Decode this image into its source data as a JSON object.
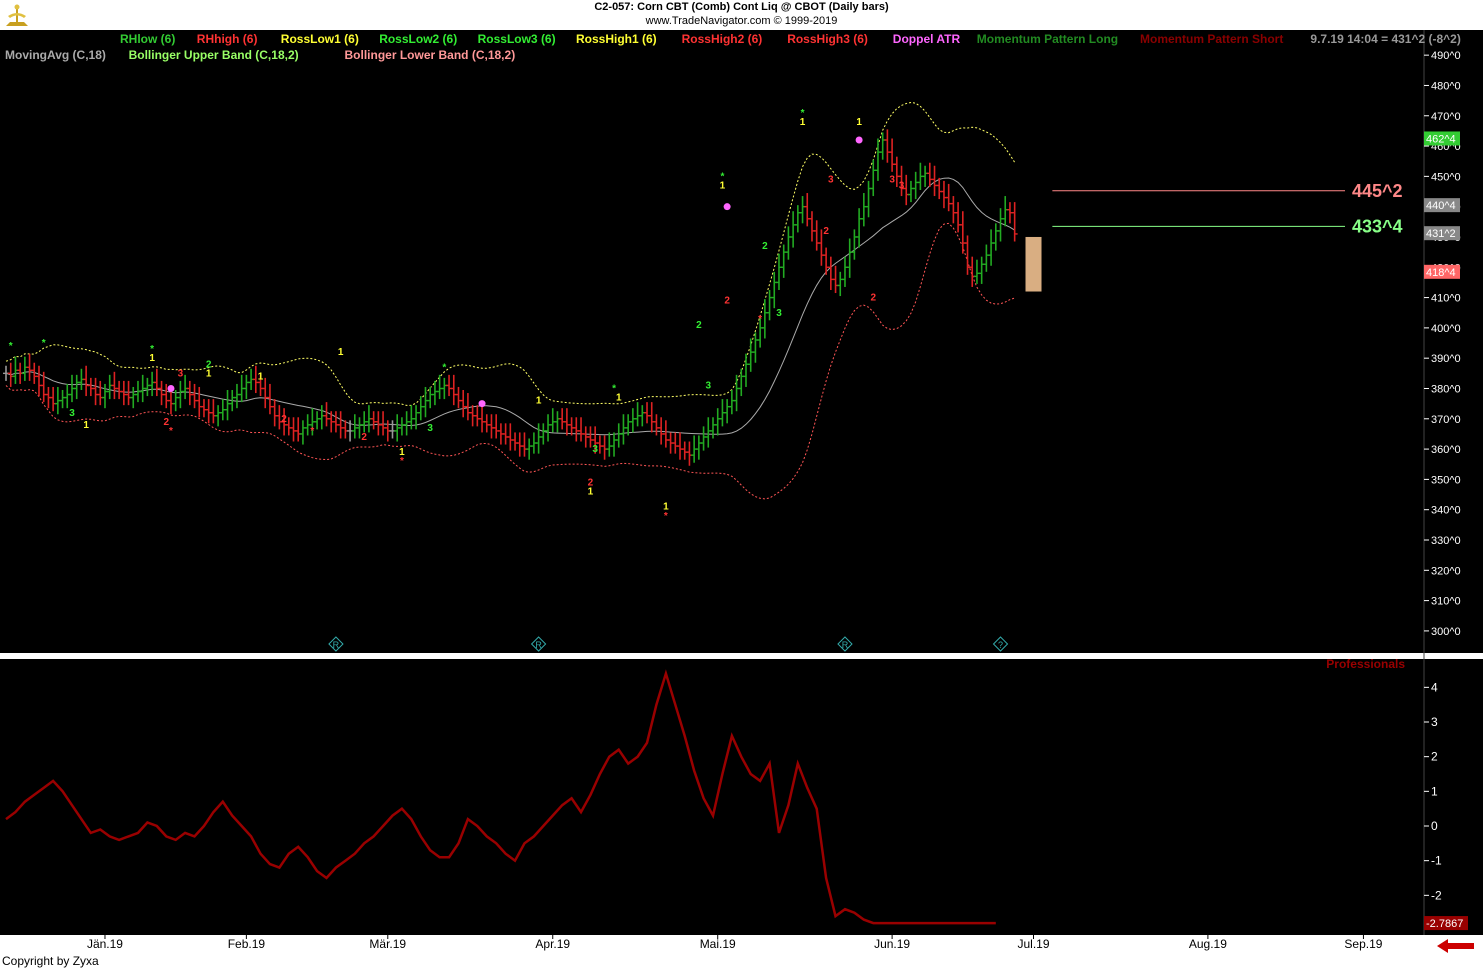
{
  "header": {
    "line1": "C2-057:  Corn CBT (Comb) Cont Liq @ CBOT  (Daily bars)",
    "line2": "www.TradeNavigator.com © 1999-2019"
  },
  "copyright": "Copyright by Zyxa",
  "legend_row1": [
    {
      "text": "RHlow (6)",
      "color": "#33cc33"
    },
    {
      "text": "RHhigh (6)",
      "color": "#ff3333"
    },
    {
      "text": "RossLow1 (6)",
      "color": "#ffff33"
    },
    {
      "text": "RossLow2 (6)",
      "color": "#33ee33"
    },
    {
      "text": "RossLow3 (6)",
      "color": "#33ee33"
    },
    {
      "text": "RossHigh1 (6)",
      "color": "#ffff33"
    },
    {
      "text": "RossHigh2 (6)",
      "color": "#ff3333"
    },
    {
      "text": "RossHigh3 (6)",
      "color": "#ff3333"
    },
    {
      "text": "Doppel ATR",
      "color": "#ff66ff"
    },
    {
      "text": "Momentum Pattern Long",
      "color": "#228b22"
    },
    {
      "text": "Momentum Pattern Short",
      "color": "#8b0000"
    },
    {
      "text": "9.7.19 14:04 = 431^2 (-8^2)",
      "color": "#999999"
    }
  ],
  "legend_row2": [
    {
      "text": "MovingAvg (C,18)",
      "color": "#aaaaaa"
    },
    {
      "text": "Bollinger Upper Band (C,18,2)",
      "color": "#99ff66"
    },
    {
      "text": "Bollinger Lower Band (C,18,2)",
      "color": "#ff9999"
    }
  ],
  "colors": {
    "background": "#000000",
    "up_bar": "#22aa22",
    "down_bar": "#dd2222",
    "neutral_bar": "#999999",
    "moving_avg": "#aaaaaa",
    "upper_band": "#ffff66",
    "lower_band": "#ff5555",
    "professionals": "#990000"
  },
  "chart_data": [
    {
      "type": "candlestick",
      "title": "Corn CBT (Comb) Cont Liq @ CBOT (Daily bars)",
      "y_unit": "cents/bu (quoted in 1/8ths, e.g. 445^2)",
      "y_ticks": [
        "490^0",
        "480^0",
        "470^0",
        "460^0",
        "450^0",
        "440^0",
        "430^0",
        "420^0",
        "410^0",
        "400^0",
        "390^0",
        "380^0",
        "370^0",
        "360^0",
        "350^0",
        "340^0",
        "330^0",
        "320^0",
        "310^0",
        "300^0"
      ],
      "ylim": [
        297,
        495
      ],
      "x_ticks": [
        "Jän.19",
        "Feb.19",
        "Mär.19",
        "Apr.19",
        "Mai.19",
        "Jun.19",
        "Jul.19",
        "Aug.19",
        "Sep.19"
      ],
      "x_tick_days": [
        21,
        51,
        81,
        116,
        151,
        188,
        218,
        255,
        288
      ],
      "bar_days": [
        0,
        1,
        2,
        3,
        4,
        5,
        6,
        7,
        8,
        9,
        10,
        11,
        12,
        13,
        14,
        15,
        16,
        17,
        18,
        19,
        20,
        21,
        22,
        23,
        24,
        25,
        26,
        27,
        28,
        29,
        30,
        31,
        32,
        33,
        34,
        35,
        36,
        37,
        38,
        39,
        40,
        41,
        42,
        43,
        44,
        45,
        46,
        47,
        48,
        49,
        50,
        51,
        52,
        53,
        54,
        55,
        56,
        57,
        58,
        59,
        60,
        61,
        62,
        63,
        64,
        65,
        66,
        67,
        68,
        69,
        70,
        71,
        72,
        73,
        74,
        75,
        76,
        77,
        78,
        79,
        80,
        81,
        82,
        83,
        84,
        85,
        86,
        87,
        88,
        89,
        90,
        91,
        92,
        93,
        94,
        95,
        96,
        97,
        98,
        99,
        100,
        101,
        102,
        103,
        104,
        105,
        106,
        107,
        108,
        109,
        110,
        111,
        112,
        113,
        114,
        115,
        116,
        117,
        118,
        119,
        120,
        121,
        122,
        123,
        124,
        125,
        126,
        127,
        128,
        129,
        130,
        131,
        132,
        133,
        134,
        135,
        136,
        137,
        138,
        139,
        140,
        141,
        142,
        143,
        144,
        145,
        146,
        147,
        148,
        149,
        150,
        151,
        152,
        153,
        154,
        155,
        156,
        157,
        158,
        159,
        160,
        161,
        162,
        163,
        164,
        165,
        166,
        167,
        168,
        169,
        170,
        171,
        172,
        173,
        174,
        175,
        176,
        177,
        178,
        179,
        180,
        181,
        182,
        183,
        184,
        185,
        186,
        187,
        188,
        189,
        190,
        191,
        192,
        193,
        194,
        195,
        196,
        197,
        198,
        199,
        200,
        201,
        202,
        203,
        204,
        205,
        206,
        207,
        208,
        209,
        210,
        211,
        212,
        213,
        214,
        215,
        216,
        217,
        218,
        219,
        220,
        221,
        222
      ],
      "closes": [
        385,
        384,
        386,
        385,
        387,
        386,
        384,
        381,
        378,
        377,
        375,
        376,
        377,
        378,
        380,
        382,
        383,
        381,
        380,
        378,
        377,
        379,
        381,
        380,
        379,
        378,
        377,
        378,
        379,
        380,
        381,
        382,
        380,
        378,
        376,
        375,
        377,
        379,
        380,
        378,
        376,
        374,
        373,
        372,
        371,
        372,
        373,
        375,
        377,
        378,
        380,
        382,
        383,
        382,
        380,
        377,
        374,
        371,
        369,
        368,
        367,
        366,
        365,
        367,
        368,
        369,
        370,
        371,
        370,
        369,
        368,
        367,
        366,
        366,
        367,
        368,
        369,
        370,
        369,
        368,
        367,
        366,
        366,
        367,
        368,
        369,
        370,
        372,
        374,
        376,
        378,
        379,
        380,
        381,
        380,
        378,
        376,
        374,
        372,
        371,
        370,
        369,
        368,
        367,
        366,
        365,
        364,
        363,
        362,
        361,
        360,
        361,
        362,
        364,
        366,
        368,
        369,
        370,
        369,
        368,
        367,
        366,
        365,
        364,
        363,
        362,
        361,
        360,
        361,
        363,
        365,
        367,
        369,
        370,
        371,
        372,
        371,
        369,
        367,
        365,
        363,
        362,
        361,
        360,
        359,
        358,
        360,
        362,
        364,
        366,
        368,
        370,
        372,
        374,
        376,
        380,
        384,
        388,
        392,
        396,
        400,
        405,
        410,
        415,
        420,
        425,
        430,
        434,
        438,
        440,
        436,
        432,
        428,
        424,
        420,
        416,
        414,
        416,
        420,
        425,
        430,
        436,
        440,
        446,
        452,
        458,
        462,
        458,
        454,
        450,
        446,
        444,
        446,
        448,
        450,
        451,
        449,
        447,
        445,
        443,
        441,
        438,
        434,
        428,
        420,
        417,
        418,
        421,
        424,
        428,
        432,
        436,
        439,
        438,
        431
      ],
      "points": [],
      "right_labels": [
        {
          "label": "462^4",
          "value": 462.5,
          "bg": "#33cc33",
          "fg": "#ffffff"
        },
        {
          "label": "440^4",
          "value": 440.5,
          "bg": "#888888",
          "fg": "#ffffff"
        },
        {
          "label": "431^2",
          "value": 431.25,
          "bg": "#888888",
          "fg": "#ffffff"
        },
        {
          "label": "418^4",
          "value": 418.5,
          "bg": "#ff6666",
          "fg": "#ffffff"
        }
      ],
      "level_lines": [
        {
          "label": "445^2",
          "value": 445.25,
          "color": "#ff8888"
        },
        {
          "label": "433^4",
          "value": 433.5,
          "color": "#88ff88"
        }
      ],
      "markers": [
        {
          "day": 1,
          "value": 393,
          "text": "*",
          "color": "#33ee33"
        },
        {
          "day": 8,
          "value": 394,
          "text": "*",
          "color": "#33ee33"
        },
        {
          "day": 31,
          "value": 392,
          "text": "*",
          "color": "#33ee33"
        },
        {
          "day": 31,
          "value": 389,
          "text": "1",
          "color": "#ffff33"
        },
        {
          "day": 37,
          "value": 384,
          "text": "3",
          "color": "#ff3333"
        },
        {
          "day": 43,
          "value": 387,
          "text": "2",
          "color": "#33ee33"
        },
        {
          "day": 43,
          "value": 384,
          "text": "1",
          "color": "#ffff33"
        },
        {
          "day": 54,
          "value": 383,
          "text": "1",
          "color": "#ffff33"
        },
        {
          "day": 71,
          "value": 391,
          "text": "1",
          "color": "#ffff33"
        },
        {
          "day": 93,
          "value": 386,
          "text": "*",
          "color": "#33ee33"
        },
        {
          "day": 113,
          "value": 375,
          "text": "1",
          "color": "#ffff33"
        },
        {
          "day": 129,
          "value": 379,
          "text": "*",
          "color": "#33ee33"
        },
        {
          "day": 130,
          "value": 376,
          "text": "1",
          "color": "#ffff33"
        },
        {
          "day": 152,
          "value": 449,
          "text": "*",
          "color": "#33ee33"
        },
        {
          "day": 152,
          "value": 446,
          "text": "1",
          "color": "#ffff33"
        },
        {
          "day": 169,
          "value": 470,
          "text": "*",
          "color": "#33ee33"
        },
        {
          "day": 169,
          "value": 467,
          "text": "1",
          "color": "#ffff33"
        },
        {
          "day": 181,
          "value": 467,
          "text": "1",
          "color": "#ffff33"
        },
        {
          "day": 188,
          "value": 448,
          "text": "3",
          "color": "#ff3333"
        },
        {
          "day": 14,
          "value": 371,
          "text": "3",
          "color": "#33ee33"
        },
        {
          "day": 17,
          "value": 367,
          "text": "1",
          "color": "#ffff33"
        },
        {
          "day": 34,
          "value": 368,
          "text": "2",
          "color": "#ff3333"
        },
        {
          "day": 35,
          "value": 365,
          "text": "*",
          "color": "#ff3333"
        },
        {
          "day": 59,
          "value": 369,
          "text": "2",
          "color": "#ff3333"
        },
        {
          "day": 65,
          "value": 365,
          "text": "*",
          "color": "#ff3333"
        },
        {
          "day": 76,
          "value": 363,
          "text": "2",
          "color": "#ff3333"
        },
        {
          "day": 84,
          "value": 358,
          "text": "1",
          "color": "#ffff33"
        },
        {
          "day": 84,
          "value": 355,
          "text": "*",
          "color": "#ff3333"
        },
        {
          "day": 90,
          "value": 366,
          "text": "3",
          "color": "#33ee33"
        },
        {
          "day": 125,
          "value": 359,
          "text": "3",
          "color": "#33ee33"
        },
        {
          "day": 124,
          "value": 348,
          "text": "2",
          "color": "#ff3333"
        },
        {
          "day": 124,
          "value": 345,
          "text": "1",
          "color": "#ffff33"
        },
        {
          "day": 140,
          "value": 340,
          "text": "1",
          "color": "#ffff33"
        },
        {
          "day": 140,
          "value": 337,
          "text": "*",
          "color": "#ff3333"
        },
        {
          "day": 147,
          "value": 400,
          "text": "2",
          "color": "#33ee33"
        },
        {
          "day": 149,
          "value": 380,
          "text": "3",
          "color": "#33ee33"
        },
        {
          "day": 153,
          "value": 408,
          "text": "2",
          "color": "#ff3333"
        },
        {
          "day": 161,
          "value": 426,
          "text": "2",
          "color": "#33ee33"
        },
        {
          "day": 160,
          "value": 402,
          "text": "*",
          "color": "#ff3333"
        },
        {
          "day": 164,
          "value": 404,
          "text": "3",
          "color": "#33ee33"
        },
        {
          "day": 174,
          "value": 431,
          "text": "2",
          "color": "#ff3333"
        },
        {
          "day": 175,
          "value": 448,
          "text": "3",
          "color": "#ff3333"
        },
        {
          "day": 184,
          "value": 409,
          "text": "2",
          "color": "#ff3333"
        },
        {
          "day": 190,
          "value": 446,
          "text": "3",
          "color": "#ff3333"
        }
      ],
      "doppel_atr_points": [
        {
          "day": 35,
          "value": 380
        },
        {
          "day": 101,
          "value": 375
        },
        {
          "day": 153,
          "value": 440
        },
        {
          "day": 181,
          "value": 462
        }
      ],
      "event_icons": [
        {
          "day": 70,
          "text": "R"
        },
        {
          "day": 113,
          "text": "R"
        },
        {
          "day": 178,
          "text": "R"
        },
        {
          "day": 211,
          "text": "?"
        }
      ]
    },
    {
      "type": "line",
      "title": "Professionals",
      "y_ticks": [
        "4",
        "3",
        "2",
        "1",
        "0",
        "-1",
        "-2"
      ],
      "ylim": [
        -3,
        4.5
      ],
      "last_value_label": "-2.7867",
      "x": [
        0,
        2,
        4,
        6,
        8,
        10,
        12,
        14,
        16,
        18,
        20,
        22,
        24,
        26,
        28,
        30,
        32,
        34,
        36,
        38,
        40,
        42,
        44,
        46,
        48,
        50,
        52,
        54,
        56,
        58,
        60,
        62,
        64,
        66,
        68,
        70,
        72,
        74,
        76,
        78,
        80,
        82,
        84,
        86,
        88,
        90,
        92,
        94,
        96,
        98,
        100,
        102,
        104,
        106,
        108,
        110,
        112,
        114,
        116,
        118,
        120,
        122,
        124,
        126,
        128,
        130,
        132,
        134,
        136,
        138,
        140,
        142,
        144,
        146,
        148,
        150,
        152,
        154,
        156,
        158,
        160,
        162,
        164,
        166,
        168,
        170,
        172,
        174,
        176,
        178,
        180,
        182,
        184,
        186,
        188,
        190,
        192,
        194,
        196,
        198,
        200,
        202,
        204,
        206,
        208,
        210
      ],
      "values": [
        0.2,
        0.4,
        0.7,
        0.9,
        1.1,
        1.3,
        1.0,
        0.6,
        0.2,
        -0.2,
        -0.1,
        -0.3,
        -0.4,
        -0.3,
        -0.2,
        0.1,
        0.0,
        -0.3,
        -0.4,
        -0.2,
        -0.3,
        0.0,
        0.4,
        0.7,
        0.3,
        0.0,
        -0.3,
        -0.8,
        -1.1,
        -1.2,
        -0.8,
        -0.6,
        -0.9,
        -1.3,
        -1.5,
        -1.2,
        -1.0,
        -0.8,
        -0.5,
        -0.3,
        0.0,
        0.3,
        0.5,
        0.2,
        -0.3,
        -0.7,
        -0.9,
        -0.9,
        -0.5,
        0.2,
        0.0,
        -0.3,
        -0.5,
        -0.8,
        -1.0,
        -0.5,
        -0.3,
        0.0,
        0.3,
        0.6,
        0.8,
        0.4,
        0.9,
        1.5,
        2.0,
        2.2,
        1.8,
        2.0,
        2.4,
        3.5,
        4.4,
        3.5,
        2.6,
        1.6,
        0.8,
        0.3,
        1.5,
        2.6,
        2.0,
        1.5,
        1.3,
        1.8,
        -0.2,
        0.6,
        1.8,
        1.1,
        0.5,
        -1.5,
        -2.6,
        -2.4,
        -2.5,
        -2.7,
        -2.8,
        -2.8,
        -2.8,
        -2.8,
        -2.8,
        -2.8,
        -2.8,
        -2.8,
        -2.8,
        -2.8,
        -2.8,
        -2.8,
        -2.8,
        -2.8
      ]
    }
  ]
}
